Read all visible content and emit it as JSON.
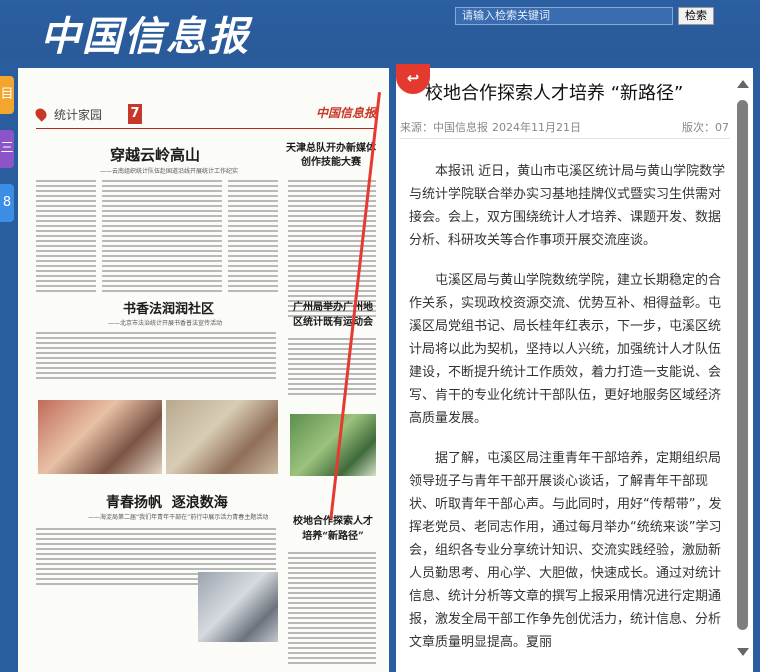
{
  "header": {
    "logo_text": "中国信息报",
    "search_placeholder": "请输入检索关键词",
    "search_button": "检索"
  },
  "side_tabs": [
    "目",
    "三",
    "8"
  ],
  "newspaper": {
    "section": "统计家园",
    "page_number": "7",
    "logo": "中国信息报",
    "headlines": {
      "main": "穿越云岭高山",
      "main_sub": "——云南组织统计队伍赴国道沿线开展统计工作纪实",
      "right_top": "天津总队开办新媒体创作技能大赛",
      "middle": "书香法润润社区",
      "middle_sub": "——北京市法治统计开展书香普法宣传活动",
      "right_middle": "广州局举办广州地区统计既有运动会",
      "bottom": "青春扬帆  逐浪数海",
      "bottom_sub": "——海淀局第二届“我们年青年干部在”前行中展示活力青春主题活动",
      "right_bottom": "校地合作探索人才培养“新路径”"
    }
  },
  "article": {
    "back_icon_char": "↩",
    "title": "校地合作探索人才培养 “新路径”",
    "source_label": "来源：中国信息报",
    "date": "2024年11月21日",
    "page_label": "版次：07",
    "paragraphs": [
      "本报讯 近日，黄山市屯溪区统计局与黄山学院数学与统计学院联合举办实习基地挂牌仪式暨实习生供需对接会。会上，双方围绕统计人才培养、课题开发、数据分析、科研攻关等合作事项开展交流座谈。",
      "屯溪区局与黄山学院数统学院，建立长期稳定的合作关系，实现政校资源交流、优势互补、相得益彰。屯溪区局党组书记、局长桂年红表示，下一步，屯溪区统计局将以此为契机，坚持以人兴统，加强统计人才队伍建设，不断提升统计工作质效，着力打造一支能说、会写、肯干的专业化统计干部队伍，更好地服务区域经济高质量发展。",
      "据了解，屯溪区局注重青年干部培养，定期组织局领导班子与青年干部开展谈心谈话，了解青年干部现状、听取青年干部心声。与此同时，用好“传帮带”，发挥老党员、老同志作用，通过每月举办“统统来谈”学习会，组织各专业分享统计知识、交流实践经验，激励新人员勤思考、用心学、大胆做，快速成长。通过对统计信息、统计分析等文章的撰写上报采用情况进行定期通报，激发全局干部工作争先创优活力，统计信息、分析文章质量明显提高。夏丽"
    ]
  }
}
